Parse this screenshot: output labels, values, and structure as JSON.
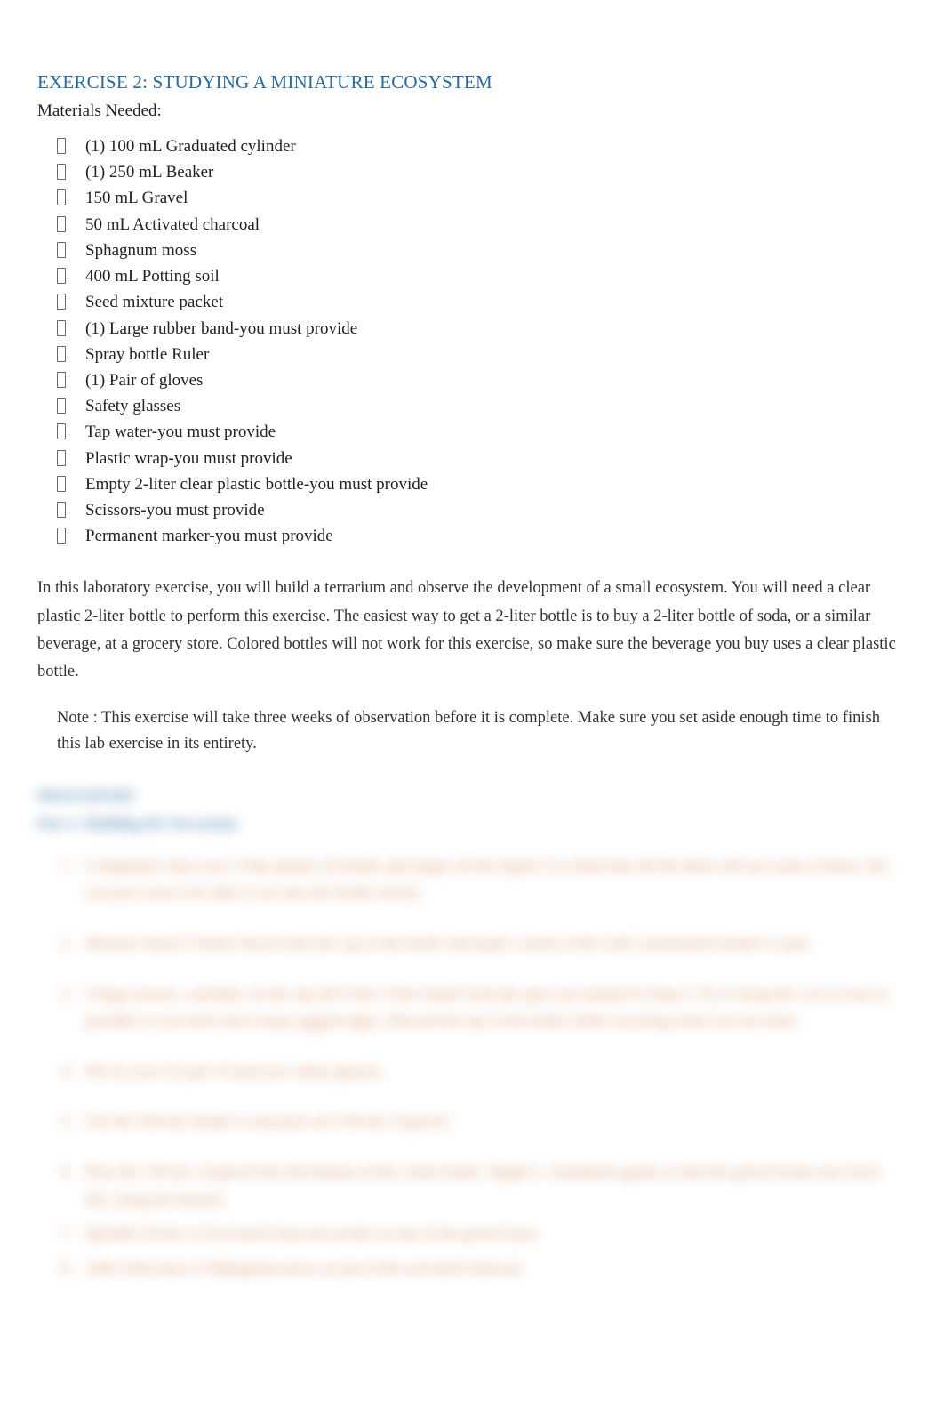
{
  "title": "EXERCISE 2: STUDYING A MINIATURE ECOSYSTEM",
  "subtitle": "Materials Needed:",
  "materials": [
    " (1) 100 mL Graduated cylinder",
    "(1) 250 mL Beaker",
    "150 mL Gravel",
    "50 mL Activated charcoal",
    "Sphagnum moss",
    "400 mL Potting soil",
    "Seed mixture packet",
    "(1) Large rubber band-you must provide",
    "Spray bottle Ruler",
    "(1) Pair of gloves",
    "Safety glasses",
    " Tap water-you must provide",
    "Plastic wrap-you must provide",
    "Empty 2-liter clear plastic bottle-you must provide",
    "Scissors-you must provide",
    "Permanent marker-you must provide"
  ],
  "intro": "In this laboratory exercise, you will build a terrarium and observe the development of a small ecosystem. You will need a clear plastic 2-liter bottle to perform this exercise. The easiest way to get a 2-liter bottle is to buy a 2-liter bottle of soda, or a similar beverage, at a grocery store. Colored bottles will not work for this exercise, so make sure the beverage you buy uses a clear plastic bottle.",
  "note": "Note : This exercise will take three weeks of observation before it is complete. Make sure you set aside enough time to finish this lab exercise in its entirety.",
  "blurred": {
    "heading1": "PROCEDURE",
    "heading2": "Part 1: Building the Terrarium",
    "steps": [
      "Completely rinse your 2-liter plastic (2) bottle and empty all the liquid. It is ideal that off the label will use some of these, but you just want to be able to see into the bottle clearly.",
      "Measure about 5 inches down from the cap of the bottle and make a mark at this with a permanent marker or pen.",
      "Using scissors, carefully cut the top off of the 2-liter bottle from the spot you marked in Step 2. Try to keep the cut as even as possible so you don't have many jagged edges. Discard the top of the bottle while recycling when you are done.",
      "Put on your (1) pair of and your safety glasses.",
      "Use the 250 mL beaker to measure out 150 mL of gravel.",
      "Pour the 150 mL of gravel into the bottom of the 2-liter bottle. Slight is. Joundation guide so that the gravel forms nice level flat, along the bottom.",
      "Sprinkle 50 mL of Activated charcoal evenly on top of the gravel layer.",
      "Add a thin layer of Sphagnum moss on top of the activated charcoal."
    ]
  }
}
